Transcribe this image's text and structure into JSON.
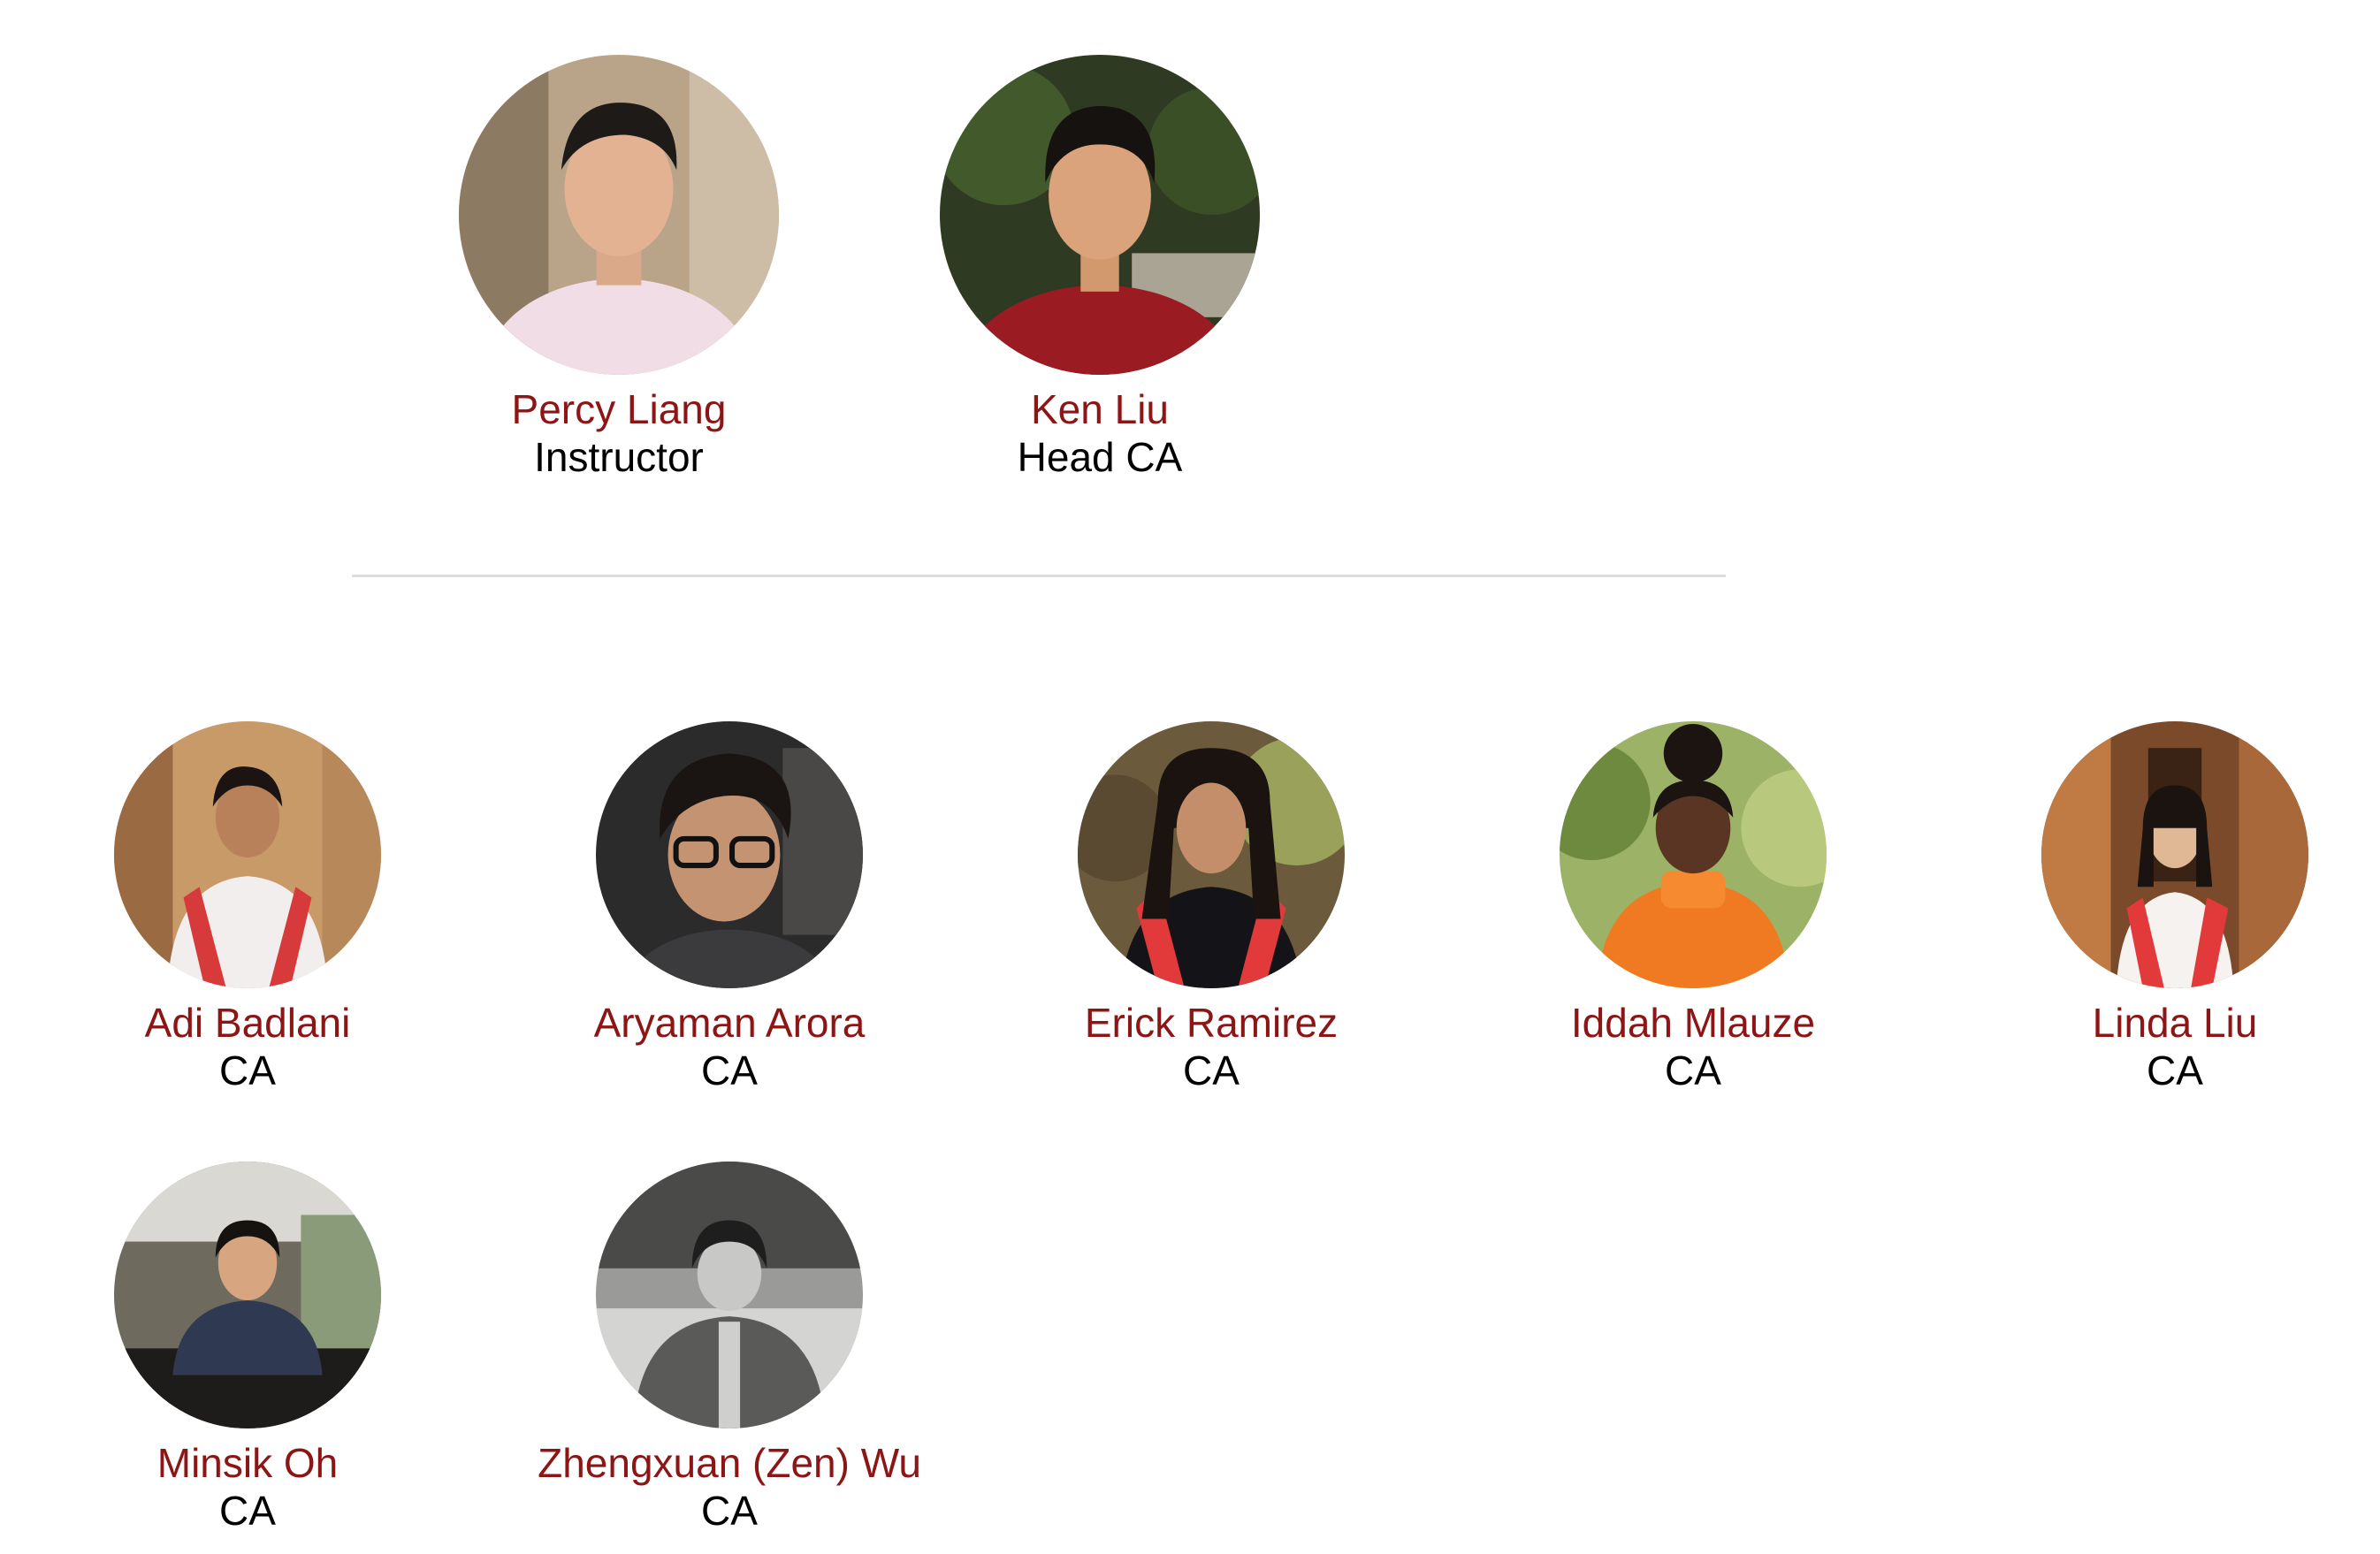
{
  "leads": [
    {
      "name": "Percy Liang",
      "role": "Instructor"
    },
    {
      "name": "Ken Liu",
      "role": "Head CA"
    }
  ],
  "cas": [
    {
      "name": "Adi Badlani",
      "role": "CA"
    },
    {
      "name": "Aryaman Arora",
      "role": "CA"
    },
    {
      "name": "Erick Ramirez",
      "role": "CA"
    },
    {
      "name": "Iddah Mlauze",
      "role": "CA"
    },
    {
      "name": "Linda Liu",
      "role": "CA"
    },
    {
      "name": "Minsik Oh",
      "role": "CA"
    },
    {
      "name": "Zhengxuan (Zen) Wu",
      "role": "CA"
    }
  ],
  "colors": {
    "name": "#8c1515",
    "role": "#000000",
    "divider": "#dcdcdc"
  },
  "icons": {
    "avatar": "profile-photo"
  }
}
